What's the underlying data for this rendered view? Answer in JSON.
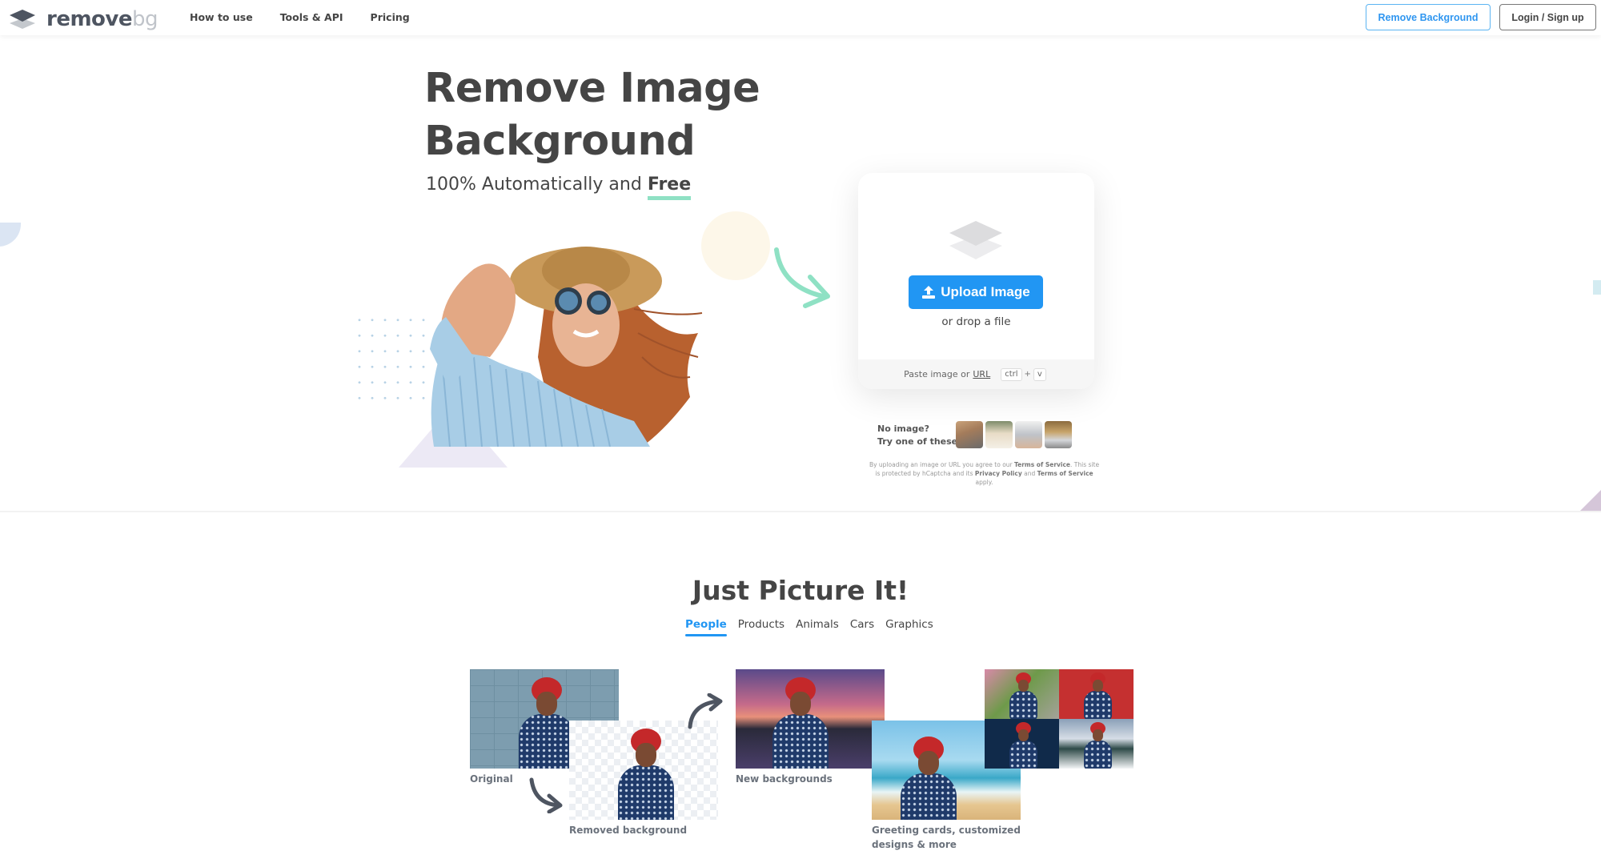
{
  "header": {
    "logo": {
      "icon": "layers-logo-icon",
      "text_primary": "remove",
      "text_secondary": "bg"
    },
    "nav": [
      {
        "label": "How to use"
      },
      {
        "label": "Tools & API"
      },
      {
        "label": "Pricing"
      }
    ],
    "buttons": {
      "remove_background": "Remove Background",
      "login": "Login / Sign up"
    }
  },
  "hero": {
    "title_line1": "Remove Image",
    "title_line2": "Background",
    "subtitle_prefix": "100% Automatically and ",
    "subtitle_emphasis": "Free",
    "colors": {
      "accent_underline": "#8fe1c4",
      "arrow": "#8fe1c4"
    }
  },
  "upload": {
    "icon": "layers-icon",
    "button_label": "Upload Image",
    "button_icon": "upload-icon",
    "drop_text": "or drop a file",
    "paste_text": "Paste image or",
    "paste_link": "URL",
    "shortcut_key1": "ctrl",
    "shortcut_plus": "+",
    "shortcut_key2": "v",
    "button_color": "#2196f3"
  },
  "samples": {
    "label_line1": "No image?",
    "label_line2": "Try one of these:",
    "thumbnails": [
      {
        "subject": "woman"
      },
      {
        "subject": "dog"
      },
      {
        "subject": "laptop"
      },
      {
        "subject": "car"
      }
    ]
  },
  "legal": {
    "text1": "By uploading an image or URL you agree to our ",
    "link1": "Terms of Service",
    "text2": ". This site is protected by hCaptcha and its ",
    "link2": "Privacy Policy",
    "text3": " and ",
    "link3": "Terms of Service",
    "text4": " apply."
  },
  "showcase": {
    "title": "Just Picture It!",
    "tabs": [
      {
        "label": "People",
        "active": true
      },
      {
        "label": "Products",
        "active": false
      },
      {
        "label": "Animals",
        "active": false
      },
      {
        "label": "Cars",
        "active": false
      },
      {
        "label": "Graphics",
        "active": false
      }
    ],
    "captions": {
      "original": "Original",
      "removed": "Removed background",
      "new_backgrounds": "New backgrounds",
      "greeting_line1": "Greeting cards, customized",
      "greeting_line2": "designs & more"
    }
  }
}
